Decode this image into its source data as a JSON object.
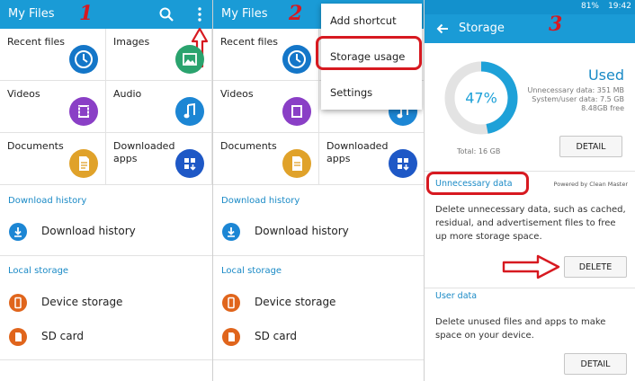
{
  "annotations": {
    "step1": "1",
    "step2": "2",
    "step3": "3"
  },
  "panel1": {
    "title": "My Files",
    "categories": [
      {
        "label": "Recent files",
        "icon": "clock-icon",
        "color": "#1476c8"
      },
      {
        "label": "Images",
        "icon": "image-icon",
        "color": "#2aa36e"
      },
      {
        "label": "Videos",
        "icon": "film-icon",
        "color": "#8a3fc6"
      },
      {
        "label": "Audio",
        "icon": "music-note-icon",
        "color": "#1c86d4"
      },
      {
        "label": "Documents",
        "icon": "document-icon",
        "color": "#e0a22a"
      },
      {
        "label": "Downloaded apps",
        "icon": "apps-grid-icon",
        "color": "#1e58c6"
      }
    ],
    "download_history_header": "Download history",
    "download_history_item": "Download history",
    "local_storage_header": "Local storage",
    "device_storage": "Device storage",
    "sd_card": "SD card"
  },
  "panel2": {
    "title": "My Files",
    "categories": [
      {
        "label": "Recent files"
      },
      {
        "label": "Videos"
      },
      {
        "label": "Documents"
      },
      {
        "label": "Downloaded apps"
      }
    ],
    "menu": [
      "Add shortcut",
      "Storage usage",
      "Settings"
    ],
    "download_history_header": "Download history",
    "download_history_item": "Download history",
    "local_storage_header": "Local storage",
    "device_storage": "Device storage",
    "sd_card": "SD card"
  },
  "panel3": {
    "status_battery": "81%",
    "status_time": "19:42",
    "title": "Storage",
    "used_percent_label": "47%",
    "used_fraction": 0.47,
    "used_label": "Used",
    "unnecessary_line": "Unnecessary data: 351 MB",
    "system_line": "System/user data: 7.5 GB",
    "free_line": "8.48GB free",
    "total_label": "Total: 16 GB",
    "detail_button": "DETAIL",
    "unnecessary_header": "Unnecessary data",
    "powered_by": "Powered by Clean Master",
    "unnecessary_desc": "Delete unnecessary data, such as cached, residual, and advertisement files to free up more storage space.",
    "delete_button": "DELETE",
    "user_data_header": "User data",
    "user_data_desc": "Delete unused files and apps to make space on your device.",
    "detail_button_2": "DETAIL"
  },
  "colors": {
    "appbar": "#1a9bd6",
    "accent_text": "#1a8ac6",
    "annotation_red": "#d71920",
    "chart_used": "#1ea1d8",
    "chart_track": "#e3e3e3"
  }
}
